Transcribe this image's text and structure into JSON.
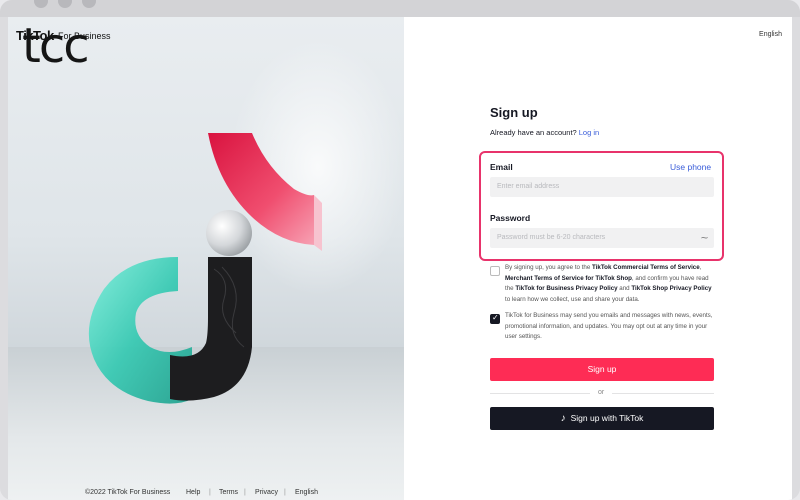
{
  "brand": {
    "wordmark": "TikTok",
    "suffix": "For Business",
    "overlay_logo": "tcc"
  },
  "language": "English",
  "footer": {
    "copyright": "©2022 TikTok For Business",
    "links": [
      "Help",
      "Terms",
      "Privacy",
      "English"
    ]
  },
  "signup": {
    "title": "Sign up",
    "have_account_text": "Already have an account?",
    "login_link": "Log in",
    "email_label": "Email",
    "use_phone": "Use phone",
    "email_placeholder": "Enter email address",
    "password_label": "Password",
    "password_placeholder": "Password must be 6-20 characters",
    "terms_checked": false,
    "terms_parts": [
      "By signing up, you agree to the ",
      "TikTok Commercial Terms of Service",
      ", ",
      "Merchant Terms of Service for TikTok Shop",
      ", and confirm you have read the ",
      "TikTok for Business Privacy Policy",
      " and ",
      "TikTok Shop Privacy Policy",
      " to learn how we collect, use and share your data."
    ],
    "marketing_checked": true,
    "marketing_text": "TikTok for Business may send you emails and messages with news, events, promotional information, and updates. You may opt out at any time in your user settings.",
    "signup_button": "Sign up",
    "or_text": "or",
    "tiktok_button": "Sign up with TikTok"
  },
  "colors": {
    "accent": "#fe2c55",
    "link": "#3a5dd9",
    "highlight": "#e8336b",
    "dark": "#161823"
  }
}
